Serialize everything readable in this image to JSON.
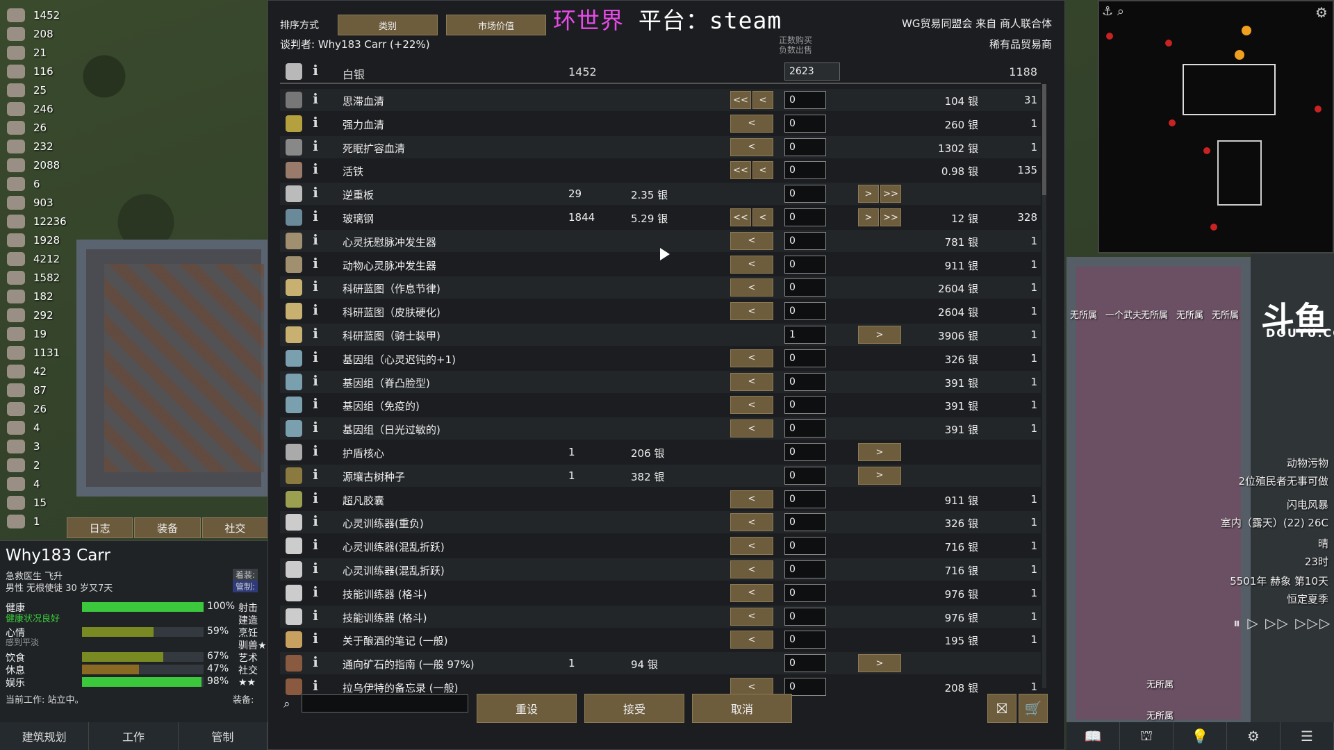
{
  "overlay": {
    "title_main": "环世界",
    "title_rest": "  平台：steam",
    "sub": "飞升"
  },
  "resources": [
    "1452",
    "208",
    "21",
    "116",
    "25",
    "246",
    "26",
    "232",
    "2088",
    "6",
    "903",
    "12236",
    "1928",
    "4212",
    "1582",
    "182",
    "292",
    "19",
    "1131",
    "42",
    "87",
    "26",
    "4",
    "3",
    "2",
    "4",
    "15",
    "1"
  ],
  "colonist_tabs": [
    "日志",
    "装备",
    "社交"
  ],
  "colonist": {
    "name": "Why183 Carr",
    "title": "急救医生 飞升",
    "desc": "男性 无根使徒 30 岁又7天",
    "badge1": "着装: ",
    "badge2": "管制: ",
    "health_note": "健康状况良好",
    "mood_note": "感到平淡",
    "needs": [
      {
        "label": "健康",
        "pct": "100%",
        "value": 100,
        "skill": "射击",
        "color": "#3cc83c"
      },
      {
        "label": "",
        "pct": "",
        "value": 0,
        "skill": "建造",
        "color": "#3cc83c"
      },
      {
        "label": "心情",
        "pct": "59%",
        "value": 59,
        "skill": "烹饪",
        "color": "#7a8a22"
      },
      {
        "label": "",
        "pct": "",
        "value": 0,
        "skill": "驯兽★",
        "color": "#7a8a22"
      },
      {
        "label": "饮食",
        "pct": "67%",
        "value": 67,
        "skill": "艺术",
        "color": "#7a8a22"
      },
      {
        "label": "休息",
        "pct": "47%",
        "value": 47,
        "skill": "社交★★",
        "color": "#8a6a22"
      },
      {
        "label": "娱乐",
        "pct": "98%",
        "value": 98,
        "skill": "",
        "color": "#3cc83c"
      }
    ],
    "current_job": "当前工作:  站立中。",
    "equip_label": "装备: "
  },
  "bottom_menu": [
    "建筑规划",
    "工作",
    "管制"
  ],
  "trade": {
    "sort_label": "排序方式",
    "sort_buttons": [
      "类别",
      "市场价值"
    ],
    "negotiator": "谈判者: Why183 Carr (+22%)",
    "faction": "WG贸易同盟会 来自 商人联合体",
    "trader_kind": "稀有品贸易商",
    "hint": [
      "正数购买",
      "负数出售"
    ],
    "silver": {
      "label": "白银",
      "colony_count": "1452",
      "qty": "2623",
      "trader_count": "1188"
    },
    "rows": [
      {
        "label": "思滞血清",
        "cc": "",
        "cp": "",
        "left": "double",
        "qty": "0",
        "right": "",
        "tp": "104 银",
        "tc": "31"
      },
      {
        "label": "强力血清",
        "cc": "",
        "cp": "",
        "left": "single",
        "qty": "0",
        "right": "",
        "tp": "260 银",
        "tc": "1"
      },
      {
        "label": "死眠扩容血清",
        "cc": "",
        "cp": "",
        "left": "single",
        "qty": "0",
        "right": "",
        "tp": "1302 银",
        "tc": "1"
      },
      {
        "label": "活铁",
        "cc": "",
        "cp": "",
        "left": "double",
        "qty": "0",
        "right": "",
        "tp": "0.98 银",
        "tc": "135"
      },
      {
        "label": "逆重板",
        "cc": "29",
        "cp": "2.35 银",
        "left": "",
        "qty": "0",
        "right": "double",
        "tp": "",
        "tc": ""
      },
      {
        "label": "玻璃钢",
        "cc": "1844",
        "cp": "5.29 银",
        "left": "double",
        "qty": "0",
        "right": "double",
        "tp": "12 银",
        "tc": "328"
      },
      {
        "label": "心灵抚慰脉冲发生器",
        "cc": "",
        "cp": "",
        "left": "single",
        "qty": "0",
        "right": "",
        "tp": "781 银",
        "tc": "1"
      },
      {
        "label": "动物心灵脉冲发生器",
        "cc": "",
        "cp": "",
        "left": "single",
        "qty": "0",
        "right": "",
        "tp": "911 银",
        "tc": "1"
      },
      {
        "label": "科研蓝图（作息节律)",
        "cc": "",
        "cp": "",
        "left": "single",
        "qty": "0",
        "right": "",
        "tp": "2604 银",
        "tc": "1"
      },
      {
        "label": "科研蓝图（皮肤硬化)",
        "cc": "",
        "cp": "",
        "left": "single",
        "qty": "0",
        "right": "",
        "tp": "2604 银",
        "tc": "1"
      },
      {
        "label": "科研蓝图（骑士装甲)",
        "cc": "",
        "cp": "",
        "left": "",
        "qty": "1",
        "right": "single",
        "tp": "3906 银",
        "tc": "1"
      },
      {
        "label": "基因组（心灵迟钝的+1)",
        "cc": "",
        "cp": "",
        "left": "single",
        "qty": "0",
        "right": "",
        "tp": "326 银",
        "tc": "1"
      },
      {
        "label": "基因组（脊凸脸型)",
        "cc": "",
        "cp": "",
        "left": "single",
        "qty": "0",
        "right": "",
        "tp": "391 银",
        "tc": "1"
      },
      {
        "label": "基因组（免疫的)",
        "cc": "",
        "cp": "",
        "left": "single",
        "qty": "0",
        "right": "",
        "tp": "391 银",
        "tc": "1"
      },
      {
        "label": "基因组（日光过敏的)",
        "cc": "",
        "cp": "",
        "left": "single",
        "qty": "0",
        "right": "",
        "tp": "391 银",
        "tc": "1"
      },
      {
        "label": "护盾核心",
        "cc": "1",
        "cp": "206 银",
        "left": "",
        "qty": "0",
        "right": "single",
        "tp": "",
        "tc": ""
      },
      {
        "label": "源壤古树种子",
        "cc": "1",
        "cp": "382 银",
        "left": "",
        "qty": "0",
        "right": "single",
        "tp": "",
        "tc": ""
      },
      {
        "label": "超凡胶囊",
        "cc": "",
        "cp": "",
        "left": "single",
        "qty": "0",
        "right": "",
        "tp": "911 银",
        "tc": "1"
      },
      {
        "label": "心灵训练器(重负)",
        "cc": "",
        "cp": "",
        "left": "single",
        "qty": "0",
        "right": "",
        "tp": "326 银",
        "tc": "1"
      },
      {
        "label": "心灵训练器(混乱折跃)",
        "cc": "",
        "cp": "",
        "left": "single",
        "qty": "0",
        "right": "",
        "tp": "716 银",
        "tc": "1"
      },
      {
        "label": "心灵训练器(混乱折跃)",
        "cc": "",
        "cp": "",
        "left": "single",
        "qty": "0",
        "right": "",
        "tp": "716 银",
        "tc": "1"
      },
      {
        "label": "技能训练器 (格斗)",
        "cc": "",
        "cp": "",
        "left": "single",
        "qty": "0",
        "right": "",
        "tp": "976 银",
        "tc": "1"
      },
      {
        "label": "技能训练器 (格斗)",
        "cc": "",
        "cp": "",
        "left": "single",
        "qty": "0",
        "right": "",
        "tp": "976 银",
        "tc": "1"
      },
      {
        "label": "关于酿酒的笔记 (一般)",
        "cc": "",
        "cp": "",
        "left": "single",
        "qty": "0",
        "right": "",
        "tp": "195 银",
        "tc": "1"
      },
      {
        "label": "通向矿石的指南 (一般 97%)",
        "cc": "1",
        "cp": "94 银",
        "left": "",
        "qty": "0",
        "right": "single",
        "tp": "",
        "tc": ""
      },
      {
        "label": "拉乌伊特的备忘录 (一般)",
        "cc": "",
        "cp": "",
        "left": "single",
        "qty": "0",
        "right": "",
        "tp": "208 银",
        "tc": "1"
      }
    ],
    "buttons": {
      "reset": "重设",
      "accept": "接受",
      "cancel": "取消"
    },
    "glyphs": {
      "ll": "<<",
      "l": "<",
      "r": ">",
      "rr": ">>"
    }
  },
  "right": {
    "bed_labels": [
      "无所属",
      "一个武夫",
      "无所属",
      "无所属",
      "无所属"
    ],
    "douyu": "斗鱼",
    "douyu_sub": "DOUYU.COM",
    "alerts": [
      "动物污物",
      "2位殖民者无事可做",
      "闪电风暴",
      "室内（露天）(22) 26C",
      "晴",
      "23时",
      "5501年 赫象 第10天",
      "恒定夏季"
    ],
    "bottom_labels": [
      "📖",
      "⛫",
      "💡",
      "⚙",
      "☰"
    ],
    "room_labels": [
      "无所属",
      "无所属"
    ]
  }
}
